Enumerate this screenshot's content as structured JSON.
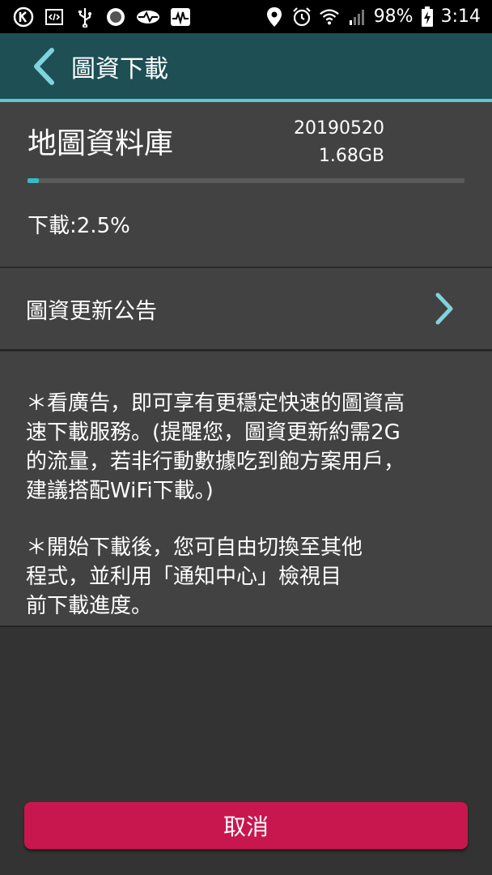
{
  "status_bar": {
    "icons": [
      "k-circle-icon",
      "code-icon",
      "usb-icon",
      "record-icon",
      "eye-icon",
      "activity-icon",
      "location-icon",
      "alarm-icon",
      "wifi-icon",
      "signal-icon",
      "battery-charging-icon"
    ],
    "battery": "98%",
    "time": "3:14"
  },
  "app_bar": {
    "title": "圖資下載",
    "back_icon": "chevron-left-icon",
    "color": "#1d4f55",
    "accent": "#5fc6d0"
  },
  "download": {
    "name": "地圖資料庫",
    "date": "20190520",
    "size": "1.68GB",
    "progress_percent": 2.5,
    "status_label": "下載:2.5%"
  },
  "announcement": {
    "label": "圖資更新公告",
    "icon": "chevron-right-icon"
  },
  "notes": {
    "note1": "＊看廣告，即可享有更穩定快速的圖資高\n速下載服務。(提醒您，圖資更新約需2G\n的流量，若非行動數據吃到飽方案用戶，\n建議搭配WiFi下載。)",
    "note2": "＊開始下載後，您可自由切換至其他\n程式，並利用「通知中心」檢視目\n前下載進度。"
  },
  "footer": {
    "cancel_label": "取消",
    "button_color": "#c8174e"
  }
}
